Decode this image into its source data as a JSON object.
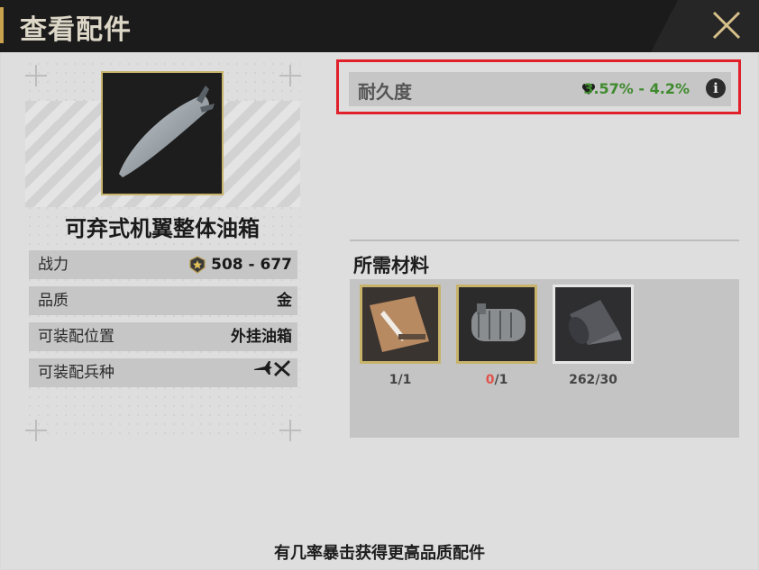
{
  "header": {
    "title": "查看配件",
    "close_icon": "close-icon"
  },
  "item": {
    "name": "可弃式机翼整体油箱",
    "image_icon": "drop-tank-icon"
  },
  "stats": [
    {
      "label": "战力",
      "value": "508 - 677",
      "icon": "star-badge-icon"
    },
    {
      "label": "品质",
      "value": "金"
    },
    {
      "label": "可装配位置",
      "value": "外挂油箱"
    },
    {
      "label": "可装配兵种",
      "value": "",
      "icon": "aircraft-type-icons"
    }
  ],
  "durability": {
    "label": "耐久度",
    "value": "3.57% - 4.2%",
    "icon": "heart-icon",
    "value_color": "#3f8a2d"
  },
  "materials": {
    "title": "所需材料",
    "items": [
      {
        "icon": "blueprint-icon",
        "have": "1",
        "need": "1",
        "insufficient": false
      },
      {
        "icon": "boiler-engine-icon",
        "have": "0",
        "need": "1",
        "insufficient": true
      },
      {
        "icon": "metal-roll-icon",
        "have": "262",
        "need": "30",
        "insufficient": false
      }
    ]
  },
  "footer_note": "有几率暴击获得更高品质配件",
  "colors": {
    "accent_gold": "#c8b36a",
    "highlight_red": "#e0202a"
  }
}
